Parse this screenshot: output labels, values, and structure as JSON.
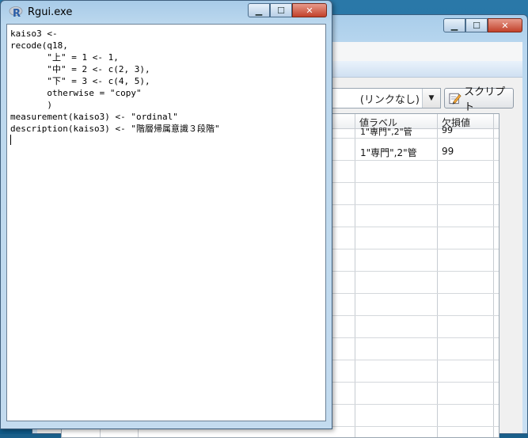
{
  "back_window": {
    "link_select": {
      "value": "(リンクなし)",
      "arrow": "▼"
    },
    "script_button": {
      "label": "スクリプト",
      "icon": "pencil-icon"
    },
    "grid": {
      "columns": [
        "値ラベル",
        "欠損値"
      ],
      "partial_first_col_header": "",
      "rows": [
        {
          "left_fragment": "l",
          "value_labels": "1\"専門\",2\"管",
          "missing": "99"
        },
        {
          "left_fragment": "l",
          "value_labels": "",
          "missing": ""
        },
        {
          "left_fragment": "l",
          "value_labels": "",
          "missing": ""
        },
        {
          "left_fragment": "l",
          "value_labels": "",
          "missing": ""
        },
        {
          "left_fragment": "l",
          "value_labels": "",
          "missing": ""
        },
        {
          "left_fragment": "l",
          "value_labels": "",
          "missing": ""
        },
        {
          "left_fragment": "l",
          "value_labels": "",
          "missing": ""
        },
        {
          "left_fragment": "l",
          "value_labels": "",
          "missing": ""
        },
        {
          "left_fragment": "l",
          "value_labels": "",
          "missing": ""
        },
        {
          "left_fragment": "l",
          "value_labels": "",
          "missing": ""
        },
        {
          "left_fragment": "l",
          "value_labels": "",
          "missing": ""
        },
        {
          "left_fragment": "l",
          "value_labels": "",
          "missing": ""
        },
        {
          "left_fragment": "l",
          "value_labels": "",
          "missing": ""
        }
      ],
      "partial_top_row": {
        "value_labels": "1\"専門\",2\"管",
        "missing": "99"
      }
    }
  },
  "rgui": {
    "title": "Rgui.exe",
    "code_lines": [
      "kaiso3 <-",
      "recode(q18,",
      "       \"上\" = 1 <- 1,",
      "       \"中\" = 2 <- c(2, 3),",
      "       \"下\" = 3 <- c(4, 5),",
      "       otherwise = \"copy\"",
      "       )",
      "measurement(kaiso3) <- \"ordinal\"",
      "description(kaiso3) <- \"階層帰属意識３段階\""
    ]
  },
  "colors": {
    "titlebar": "#bcd8ee",
    "close_button": "#c2412a",
    "editor_bg": "#ffffff"
  }
}
